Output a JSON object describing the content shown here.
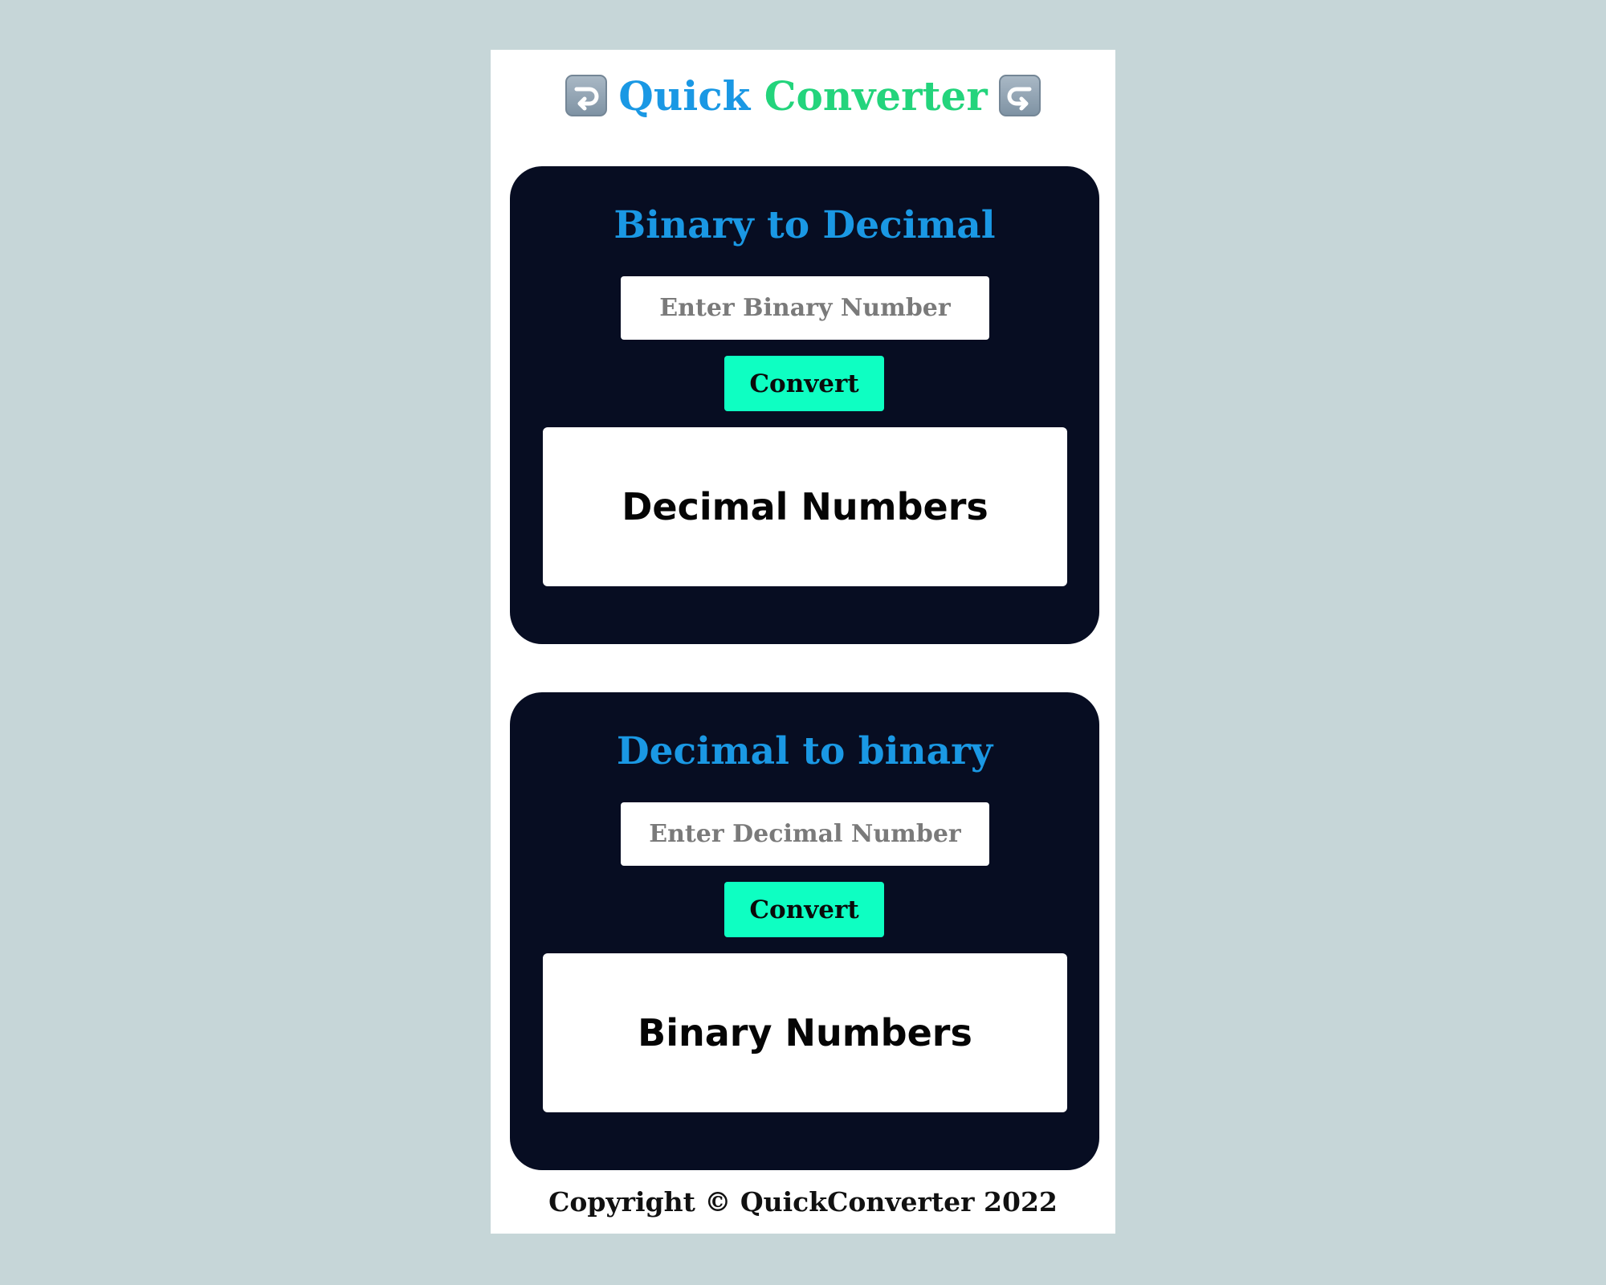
{
  "header": {
    "title_word_1": "Quick",
    "title_word_2": "Converter",
    "left_icon": "right-arrow-curving-left-icon",
    "right_icon": "left-arrow-curving-right-icon"
  },
  "binary_to_decimal": {
    "title": "Binary to Decimal",
    "input_placeholder": "Enter Binary Number",
    "input_value": "",
    "button_label": "Convert",
    "result": "Decimal Numbers"
  },
  "decimal_to_binary": {
    "title": "Decimal to binary",
    "input_placeholder": "Enter Decimal Number",
    "input_value": "",
    "button_label": "Convert",
    "result": "Binary Numbers"
  },
  "footer": {
    "text": "Copyright © QuickConverter 2022"
  },
  "colors": {
    "page_background": "#c6d6d8",
    "card_background": "#070d22",
    "title_blue": "#1a98e4",
    "title_green": "#23d47c",
    "button": "#0effc2"
  }
}
